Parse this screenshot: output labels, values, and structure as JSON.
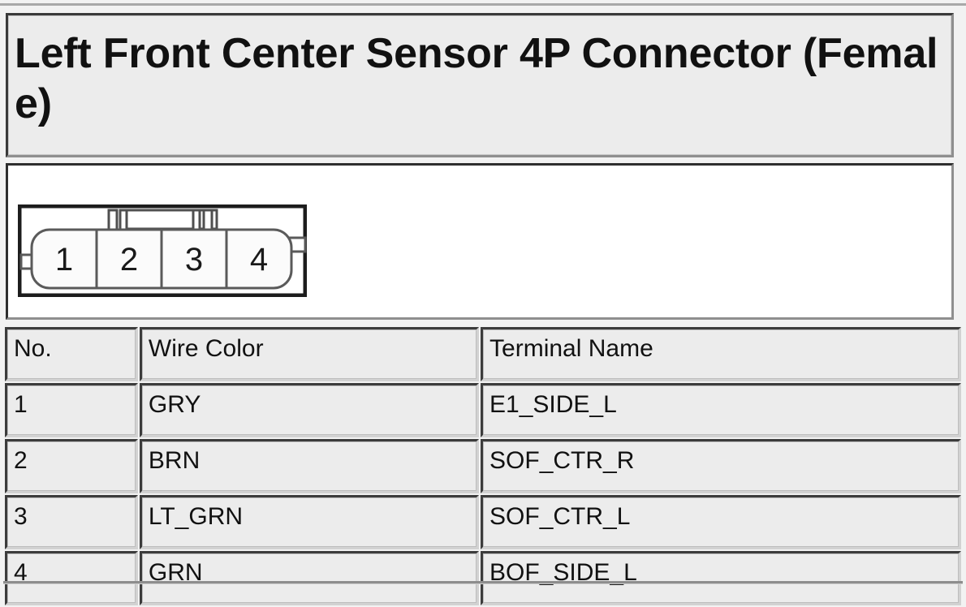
{
  "colors": {
    "page_background": "#f2f2f2",
    "panel_background": "#ececec",
    "diagram_background": "#ffffff",
    "border_dark": "#3a3a3a",
    "border_light": "#d2d2d2",
    "text": "#111111"
  },
  "title": {
    "text": "Left Front Center Sensor 4P Connector (Female)"
  },
  "connector_diagram": {
    "label": "connector-pin-layout",
    "pin_count": 4,
    "pin_labels": [
      "1",
      "2",
      "3",
      "4"
    ],
    "view": "Female",
    "features": {
      "top_tabs": 4,
      "left_nub": 1,
      "right_nub": 1
    }
  },
  "table": {
    "headers": [
      "No.",
      "Wire Color",
      "Terminal Name"
    ],
    "rows": [
      {
        "no": "1",
        "wire_color": "GRY",
        "terminal_name": "E1_SIDE_L"
      },
      {
        "no": "2",
        "wire_color": "BRN",
        "terminal_name": "SOF_CTR_R"
      },
      {
        "no": "3",
        "wire_color": "LT_GRN",
        "terminal_name": "SOF_CTR_L"
      },
      {
        "no": "4",
        "wire_color": "GRN",
        "terminal_name": "BOF_SIDE_L"
      }
    ]
  }
}
